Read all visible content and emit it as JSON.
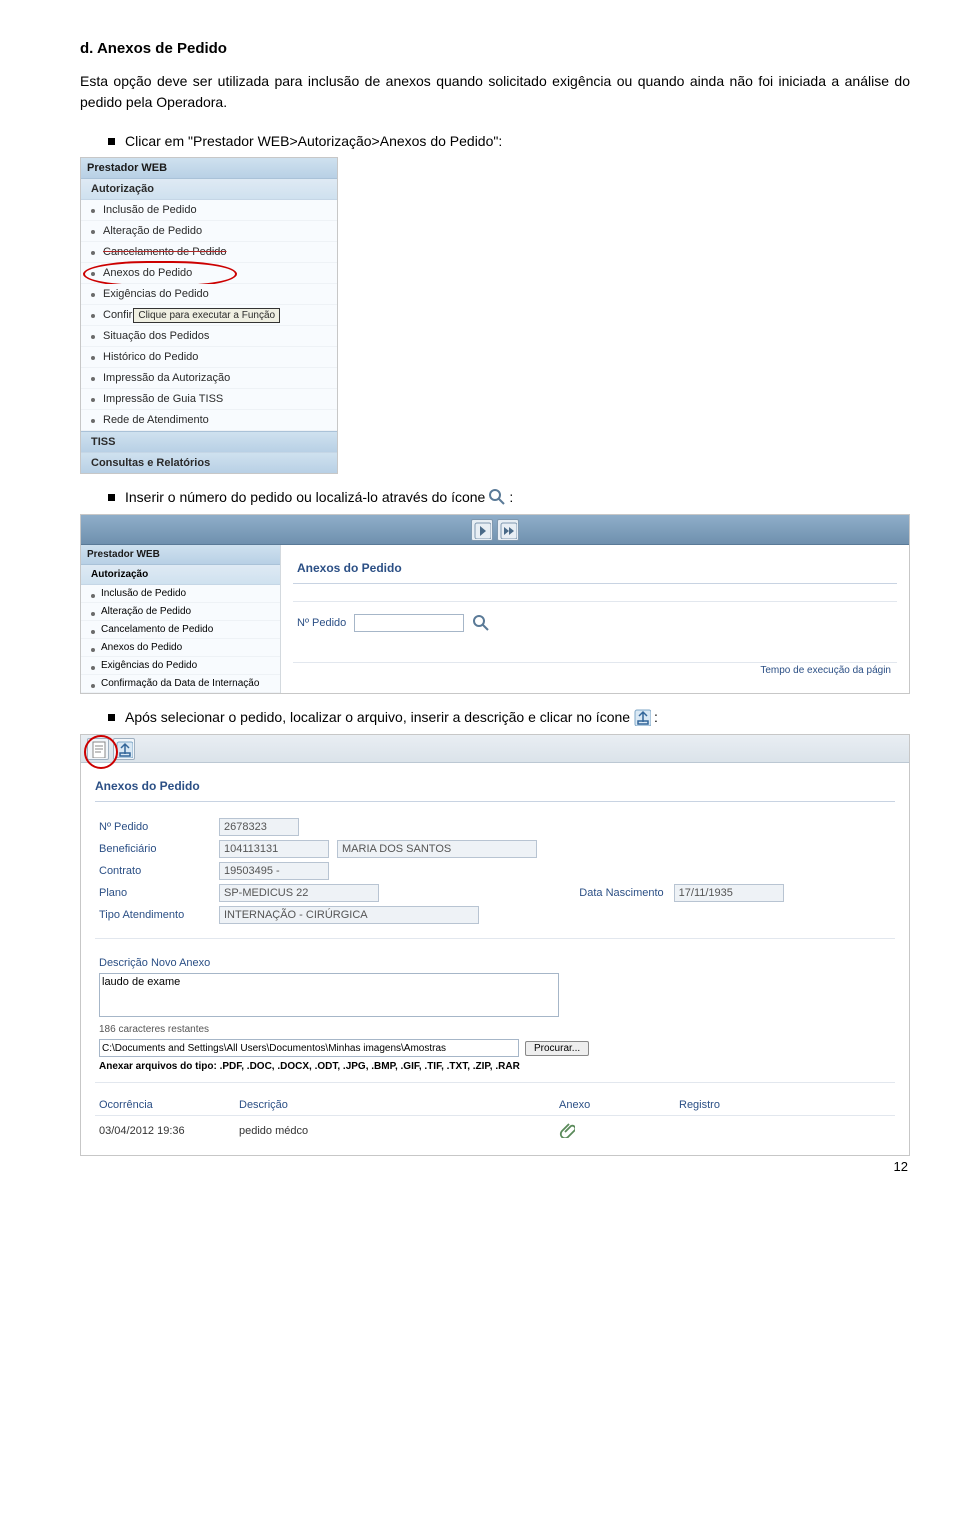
{
  "section_title": "d.  Anexos de Pedido",
  "intro": "Esta opção deve ser utilizada para inclusão de anexos quando solicitado exigência ou quando ainda não foi iniciada a análise do pedido pela Operadora.",
  "bullets": {
    "b1_prefix": "Clicar em \"Prestador WEB>Autorização>Anexos do Pedido\":",
    "b2_prefix": "Inserir o número do pedido ou localizá-lo através do ícone",
    "b2_suffix": ":",
    "b3_prefix": "Após selecionar o pedido, localizar o arquivo, inserir a descrição e clicar no ícone",
    "b3_suffix": ":"
  },
  "menu1": {
    "header": "Prestador WEB",
    "sub": "Autorização",
    "items": [
      "Inclusão de Pedido",
      "Alteração de Pedido",
      "Cancelamento de Pedido",
      "Anexos do Pedido",
      "Exigências do Pedido"
    ],
    "tooltip": "Clique para executar a Função",
    "conf_label_prefix": "Confir",
    "items2": [
      "Situação dos Pedidos",
      "Histórico do Pedido",
      "Impressão da Autorização",
      "Impressão de Guia TISS",
      "Rede de Atendimento"
    ],
    "foot1": "TISS",
    "foot2": "Consultas e Relatórios"
  },
  "wide": {
    "side_header": "Prestador WEB",
    "side_sub": "Autorização",
    "side_items": [
      "Inclusão de Pedido",
      "Alteração de Pedido",
      "Cancelamento de Pedido",
      "Anexos do Pedido",
      "Exigências do Pedido",
      "Confirmação da Data de Internação"
    ],
    "panel_title": "Anexos do Pedido",
    "np_label": "Nº Pedido",
    "np_value": "",
    "footer": "Tempo de execução da págin"
  },
  "big": {
    "panel_title": "Anexos do Pedido",
    "labels": {
      "np": "Nº Pedido",
      "benef": "Beneficiário",
      "contrato": "Contrato",
      "plano": "Plano",
      "data_nasc": "Data Nascimento",
      "tipo_at": "Tipo Atendimento",
      "desc_novo": "Descrição Novo Anexo",
      "browse": "Procurar...",
      "char_left": "186 caracteres restantes",
      "tipos": "Anexar arquivos do tipo: .PDF, .DOC, .DOCX, .ODT, .JPG, .BMP, .GIF, .TIF, .TXT, .ZIP, .RAR"
    },
    "vals": {
      "np": "2678323",
      "benef_cod": "104113131",
      "benef_nome": "MARIA DOS SANTOS",
      "contrato": "19503495 -",
      "plano": "SP-MEDICUS 22",
      "data_nasc": "17/11/1935",
      "tipo_at": "INTERNAÇÃO - CIRÚRGICA",
      "desc": "laudo de exame",
      "file": "C:\\Documents and Settings\\All Users\\Documentos\\Minhas imagens\\Amostras"
    },
    "table": {
      "h_ocorr": "Ocorrência",
      "h_desc": "Descrição",
      "h_anexo": "Anexo",
      "h_reg": "Registro",
      "r_ocorr": "03/04/2012 19:36",
      "r_desc": "pedido médco"
    }
  },
  "page_number": "12"
}
